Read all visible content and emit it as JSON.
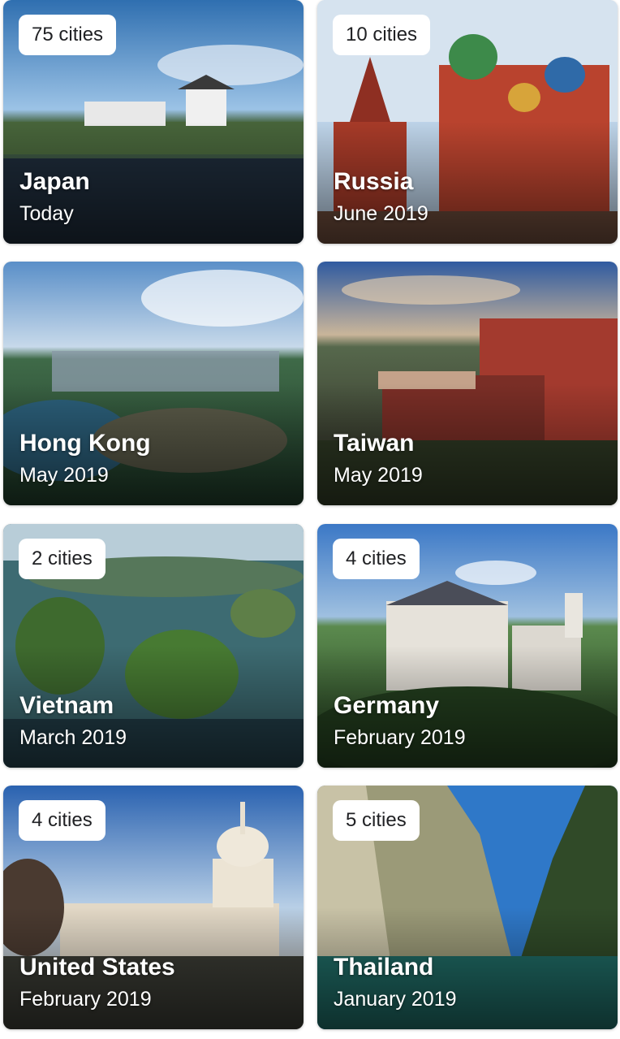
{
  "trips": [
    {
      "country": "Japan",
      "date": "Today",
      "cities": "75 cities"
    },
    {
      "country": "Russia",
      "date": "June 2019",
      "cities": "10 cities"
    },
    {
      "country": "Hong Kong",
      "date": "May 2019",
      "cities": ""
    },
    {
      "country": "Taiwan",
      "date": "May 2019",
      "cities": ""
    },
    {
      "country": "Vietnam",
      "date": "March 2019",
      "cities": "2 cities"
    },
    {
      "country": "Germany",
      "date": "February 2019",
      "cities": "4 cities"
    },
    {
      "country": "United States",
      "date": "February 2019",
      "cities": "4 cities"
    },
    {
      "country": "Thailand",
      "date": "January 2019",
      "cities": "5 cities"
    }
  ]
}
